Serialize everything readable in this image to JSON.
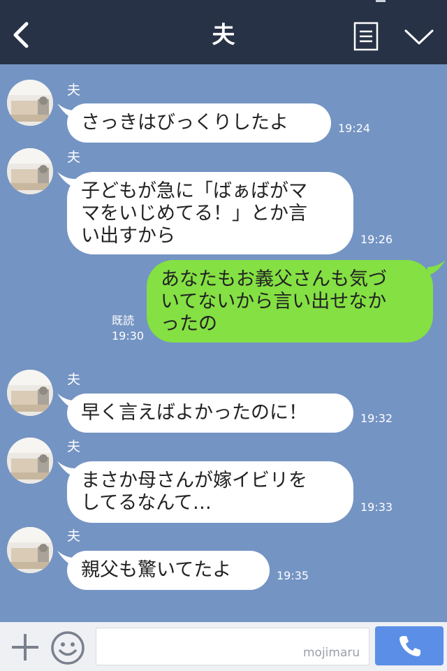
{
  "header": {
    "title": "夫",
    "back_icon": "chevron-left-icon",
    "menu_icon": "list-icon",
    "expand_icon": "chevron-down-icon"
  },
  "messages": [
    {
      "sender": "夫",
      "text": "さっきはびっくりしたよ",
      "time": "19:24"
    },
    {
      "sender": "夫",
      "lines": [
        "子どもが急に「ばぁばがマ",
        "マをいじめてる！」とか言",
        "い出すから"
      ],
      "time": "19:26"
    },
    {
      "lines": [
        "あなたもお義父さんも気づ",
        "いてないから言い出せなか",
        "ったの"
      ],
      "read": "既読",
      "time": "19:30"
    },
    {
      "sender": "夫",
      "text": "早く言えばよかったのに！",
      "time": "19:32"
    },
    {
      "sender": "夫",
      "lines": [
        "まさか母さんが嫁イビリを",
        "してるなんて…"
      ],
      "time": "19:33"
    },
    {
      "sender": "夫",
      "text": "親父も驚いてたよ",
      "time": "19:35"
    }
  ],
  "input": {
    "placeholder": "",
    "watermark": "mojimaru"
  },
  "colors": {
    "background": "#7494c3",
    "header": "#273246",
    "incoming_bubble": "#ffffff",
    "outgoing_bubble": "#84e043",
    "send_button": "#5b8ee6"
  }
}
